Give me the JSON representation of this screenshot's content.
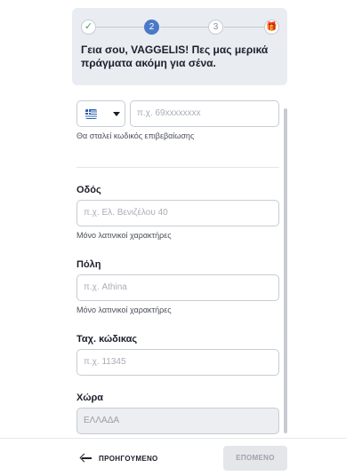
{
  "stepper": {
    "steps": [
      {
        "label": "✓",
        "state": "done"
      },
      {
        "label": "2",
        "state": "active"
      },
      {
        "label": "3",
        "state": "pending"
      },
      {
        "label": "🎁",
        "state": "gift"
      }
    ]
  },
  "header": {
    "greeting": "Γεια σου, VAGGELIS! Πες μας μερικά πράγματα ακόμη για σένα."
  },
  "phone": {
    "country_flag": "greece-flag",
    "placeholder": "π.χ. 69xxxxxxxx",
    "hint": "Θα σταλεί κωδικός επιβεβαίωσης"
  },
  "street": {
    "label": "Οδός",
    "placeholder": "π.χ. Ελ. Βενιζέλου 40",
    "hint": "Μόνο λατινικοί χαρακτήρες"
  },
  "city": {
    "label": "Πόλη",
    "placeholder": "π.χ. Athina",
    "hint": "Μόνο λατινικοί χαρακτήρες"
  },
  "postal": {
    "label": "Ταχ. κώδικας",
    "placeholder": "π.χ. 11345"
  },
  "country": {
    "label": "Χώρα",
    "value": "ΕΛΛΑΔΑ"
  },
  "footer": {
    "back_label": "ΠΡΟΗΓΟΥΜΕΝΟ",
    "next_label": "ΕΠΟΜΕΝΟ"
  },
  "colors": {
    "accent": "#4a79c7",
    "done_check": "#3aa35c",
    "header_bg": "#e9ecf1"
  }
}
